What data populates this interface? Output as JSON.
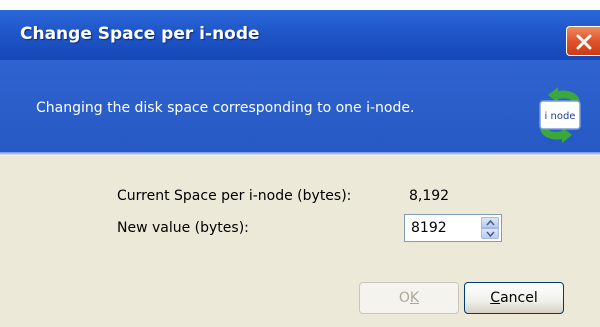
{
  "window": {
    "title": "Change Space per i-node",
    "close_icon": "close-icon"
  },
  "header": {
    "description": "Changing the disk space corresponding to one i-node.",
    "icon_label": "i node"
  },
  "form": {
    "current_label": "Current Space per i-node (bytes):",
    "current_value": "8,192",
    "new_label": "New value (bytes):",
    "new_value": "8192"
  },
  "buttons": {
    "ok_label": "OK",
    "ok_mnemonic": "K",
    "ok_prefix": "O",
    "cancel_label": "Cancel",
    "cancel_mnemonic": "C",
    "cancel_rest": "ancel"
  },
  "colors": {
    "title_bar": "#1f56c8",
    "close_button": "#e0532b",
    "dialog_body": "#ece9d8"
  }
}
